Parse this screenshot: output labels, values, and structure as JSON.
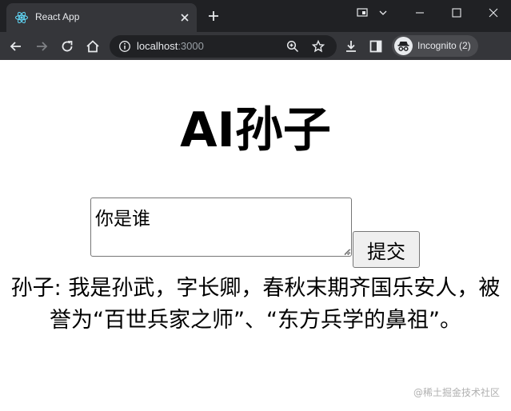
{
  "browser": {
    "tab_title": "React App",
    "url_host": "localhost",
    "url_port": ":3000",
    "profile_label": "Incognito (2)",
    "icons": [
      "react-favicon",
      "close-icon",
      "plus-icon",
      "back-icon",
      "forward-icon",
      "reload-icon",
      "home-icon",
      "info-icon",
      "zoom-icon",
      "star-icon",
      "download-icon",
      "side-panel-icon",
      "incognito-icon",
      "minimize-icon",
      "maximize-icon",
      "close-window-icon",
      "tab-search-icon",
      "cast-icon"
    ]
  },
  "app": {
    "title": "AI孙子",
    "question_value": "你是谁",
    "submit_label": "提交",
    "answer": "孙子: 我是孙武，字长卿，春秋末期齐国乐安人，被誉为“百世兵家之师”、“东方兵学的鼻祖”。"
  },
  "watermark": "@稀土掘金技术社区",
  "colors": {
    "chrome_dark": "#202124",
    "chrome_toolbar": "#35363a",
    "page_bg": "#ffffff"
  }
}
